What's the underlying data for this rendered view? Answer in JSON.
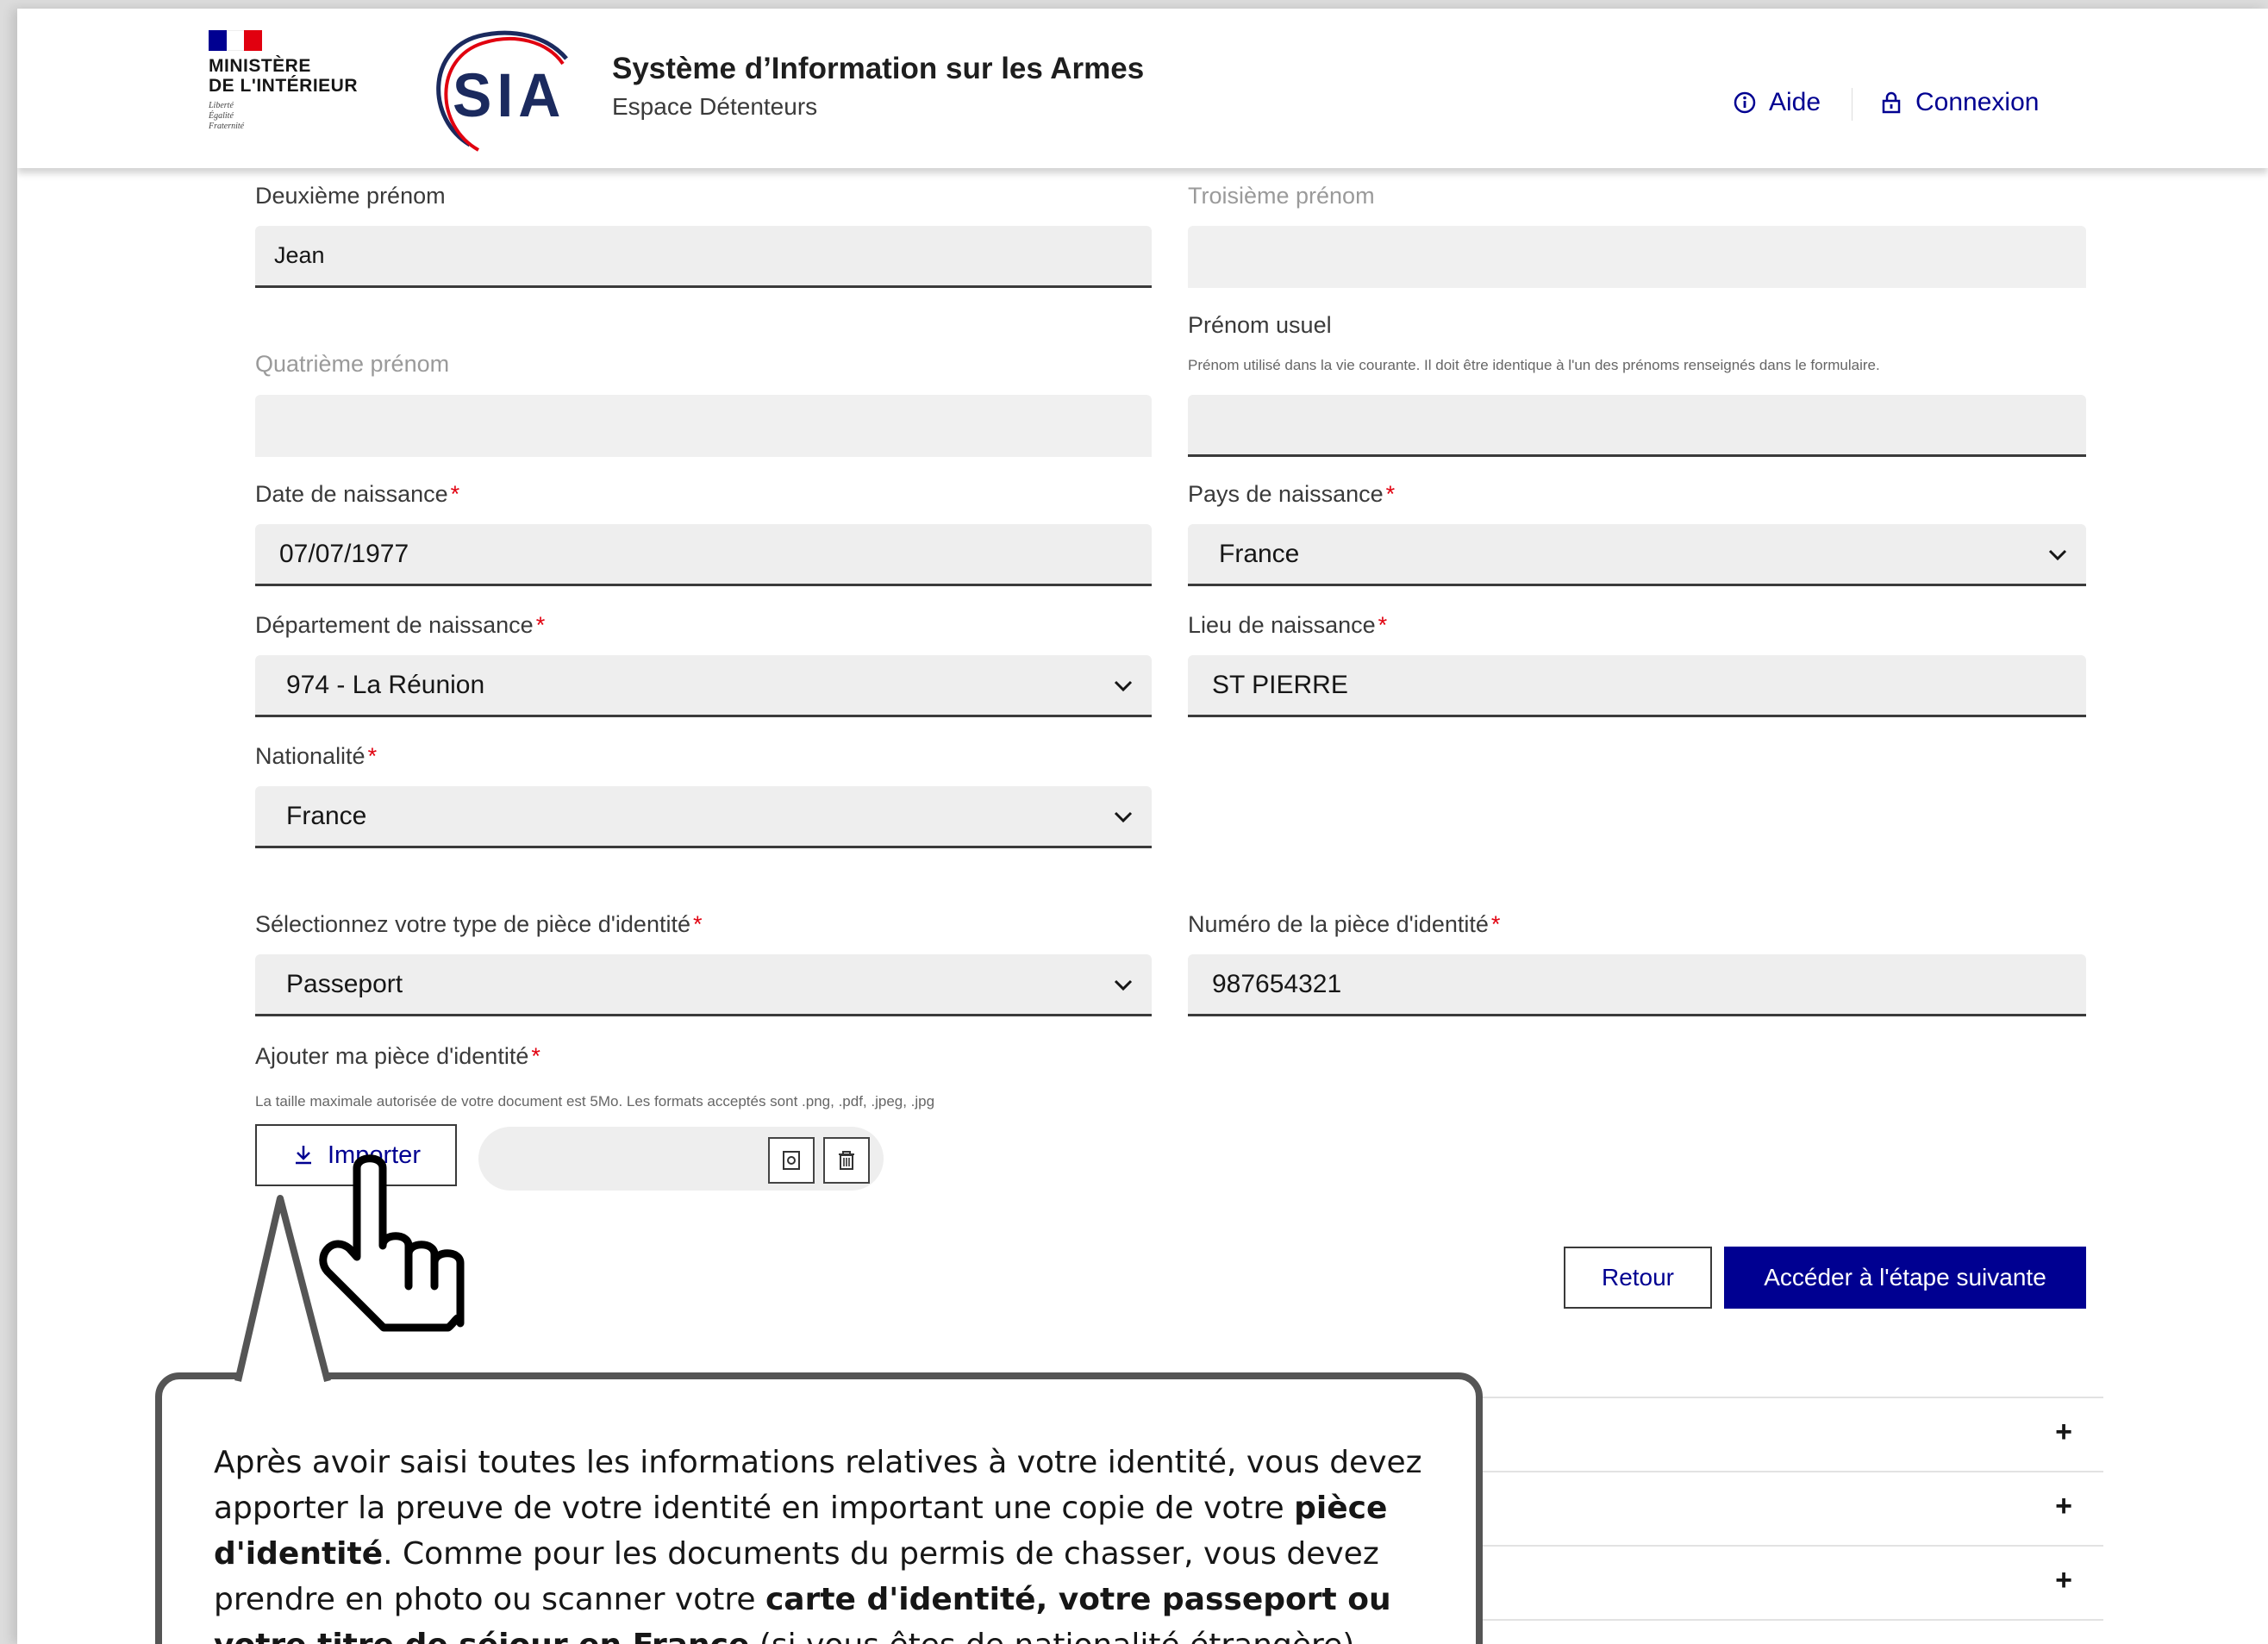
{
  "header": {
    "ministry_name": "MINISTÈRE\nDE L'INTÉRIEUR",
    "ministry_motto": "Liberté\nÉgalité\nFraternité",
    "logo_text": "SIA",
    "app_title": "Système d’Information sur les Armes",
    "app_subtitle": "Espace Détenteurs",
    "help_label": "Aide",
    "login_label": "Connexion",
    "flag_colors": [
      "#000091",
      "#ffffff",
      "#e1000f"
    ]
  },
  "form": {
    "second_name": {
      "label": "Deuxième prénom",
      "value": "Jean"
    },
    "third_name": {
      "label": "Troisième prénom",
      "value": ""
    },
    "fourth_name": {
      "label": "Quatrième prénom",
      "value": ""
    },
    "usual_name": {
      "label": "Prénom usuel",
      "hint": "Prénom utilisé dans la vie courante. Il doit être identique à l'un des prénoms renseignés dans le formulaire.",
      "value": ""
    },
    "birth_date": {
      "label": "Date de naissance",
      "value": "07/07/1977"
    },
    "birth_country": {
      "label": "Pays de naissance",
      "value": "France"
    },
    "birth_department": {
      "label": "Département de naissance",
      "value": "974 - La Réunion"
    },
    "birth_place": {
      "label": "Lieu de naissance",
      "value": "ST PIERRE"
    },
    "nationality": {
      "label": "Nationalité",
      "value": "France"
    },
    "id_type": {
      "label": "Sélectionnez votre type de pièce d'identité",
      "value": "Passeport"
    },
    "id_number": {
      "label": "Numéro de la pièce d'identité",
      "value": "987654321"
    },
    "id_upload": {
      "label": "Ajouter ma pièce d'identité",
      "hint": "La taille maximale autorisée de votre document est 5Mo. Les formats acceptés sont .png, .pdf, .jpeg, .jpg",
      "button_label": "Importer"
    },
    "required_mark": "*"
  },
  "actions": {
    "back_label": "Retour",
    "next_label": "Accéder à l'étape suivante"
  },
  "accordion": {
    "expand_symbol": "+"
  },
  "tutorial": {
    "part1": "Après avoir saisi toutes les informations relatives à votre identité, vous devez apporter la preuve de votre identité en important une copie de votre ",
    "bold1": "pièce d'identité",
    "part2": ". Comme pour les documents du permis de chasser, vous devez prendre en photo ou scanner votre ",
    "bold2": "carte d'identité, votre passeport ou votre titre de séjour en France",
    "part3": " (si vous êtes de nationalité étrangère)."
  },
  "colors": {
    "primary": "#000091",
    "required": "#e1000f",
    "field_bg": "#eeeeee"
  }
}
